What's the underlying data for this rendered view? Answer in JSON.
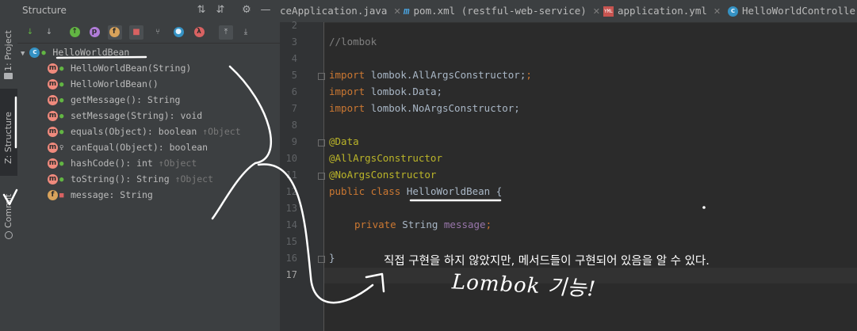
{
  "left_strip": {
    "tabs": [
      {
        "label": "1: Project"
      },
      {
        "label": "Z: Structure"
      },
      {
        "label": "Commit"
      }
    ]
  },
  "structure": {
    "title": "Structure",
    "tree": {
      "root": "HelloWorldBean",
      "items": [
        {
          "icon": "m",
          "text": "HelloWorldBean(String)",
          "inherited": ""
        },
        {
          "icon": "m",
          "text": "HelloWorldBean()",
          "inherited": ""
        },
        {
          "icon": "m",
          "text": "getMessage(): String",
          "inherited": ""
        },
        {
          "icon": "m",
          "text": "setMessage(String): void",
          "inherited": ""
        },
        {
          "icon": "m",
          "text": "equals(Object): boolean",
          "inherited": "↑Object"
        },
        {
          "icon": "m",
          "text": "canEqual(Object): boolean",
          "inherited": ""
        },
        {
          "icon": "m",
          "text": "hashCode(): int",
          "inherited": "↑Object"
        },
        {
          "icon": "m",
          "text": "toString(): String",
          "inherited": "↑Object"
        },
        {
          "icon": "f",
          "text": "message: String",
          "inherited": ""
        }
      ]
    }
  },
  "editor": {
    "tabs": [
      {
        "label": "ceApplication.java"
      },
      {
        "label": "pom.xml (restful-web-service)"
      },
      {
        "label": "application.yml"
      },
      {
        "label": "HelloWorldController.java"
      }
    ],
    "line_numbers": [
      "2",
      "3",
      "4",
      "5",
      "6",
      "7",
      "8",
      "9",
      "10",
      "11",
      "12",
      "13",
      "14",
      "15",
      "16",
      "17"
    ],
    "code": {
      "l3": "//lombok",
      "l5_kw": "import ",
      "l5_rest": "lombok.AllArgsConstructor;",
      "l6_kw": "import ",
      "l6_rest": "lombok.Data;",
      "l7_kw": "import ",
      "l7_rest": "lombok.NoArgsConstructor;",
      "l9": "@Data",
      "l10": "@AllArgsConstructor",
      "l11": "@NoArgsConstructor",
      "l12_kw": "public class ",
      "l12_name": "HelloWorldBean",
      "l12_rest": " {",
      "l14_kw": "private ",
      "l14_type": "String ",
      "l14_field": "message",
      "l14_end": ";",
      "l16": "}"
    }
  },
  "annotation": {
    "note": "직접 구현을 하지 않았지만, 메서드들이 구현되어 있음을 알 수 있다.",
    "handwriting": "Lombok 기능!"
  }
}
